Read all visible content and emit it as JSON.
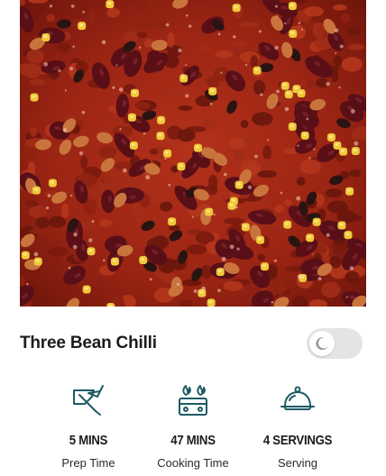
{
  "recipe": {
    "title": "Three Bean Chilli",
    "image_alt": "Three bean chilli in a pan",
    "toggle": {
      "state": "off",
      "icon": "moon-icon"
    }
  },
  "stats": [
    {
      "icon": "prep-knife-icon",
      "value": "5 MINS",
      "label": "Prep Time"
    },
    {
      "icon": "stove-burner-icon",
      "value": "47 MINS",
      "label": "Cooking Time"
    },
    {
      "icon": "serving-cloche-icon",
      "value": "4 SERVINGS",
      "label": "Serving"
    }
  ],
  "colors": {
    "icon_teal": "#1e5b63",
    "text_dark": "#1c1c1c",
    "toggle_track": "#e4e4e4"
  }
}
